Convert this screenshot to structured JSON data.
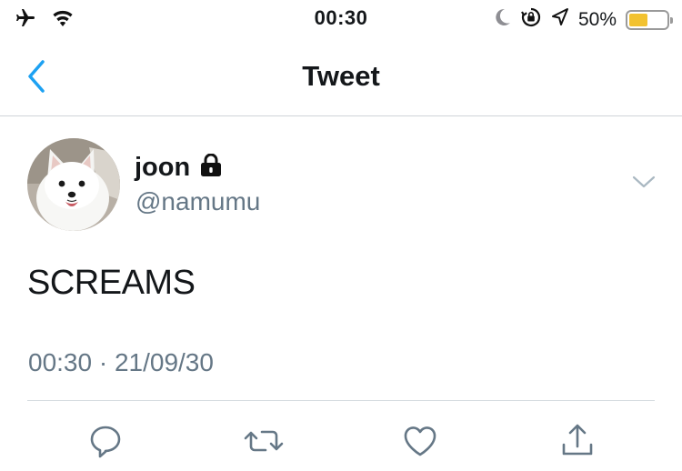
{
  "status_bar": {
    "time": "00:30",
    "battery_percent": "50%",
    "battery_level": 0.5,
    "icons": [
      "airplane-icon",
      "wifi-icon",
      "moon-icon",
      "orientation-lock-icon",
      "location-icon",
      "battery-icon"
    ]
  },
  "nav": {
    "title": "Tweet",
    "back_icon": "chevron-left-icon"
  },
  "tweet": {
    "display_name": "joon",
    "protected_icon": "lock-icon",
    "handle": "@namumu",
    "text": "SCREAMS",
    "timestamp": "00:30 · 21/09/30",
    "more_icon": "chevron-down-icon"
  },
  "actions": [
    "reply-icon",
    "retweet-icon",
    "like-icon",
    "share-icon"
  ],
  "colors": {
    "accent": "#1da1f2",
    "secondary_text": "#657786",
    "icon_gray": "#657786",
    "battery": "#f2c230"
  }
}
